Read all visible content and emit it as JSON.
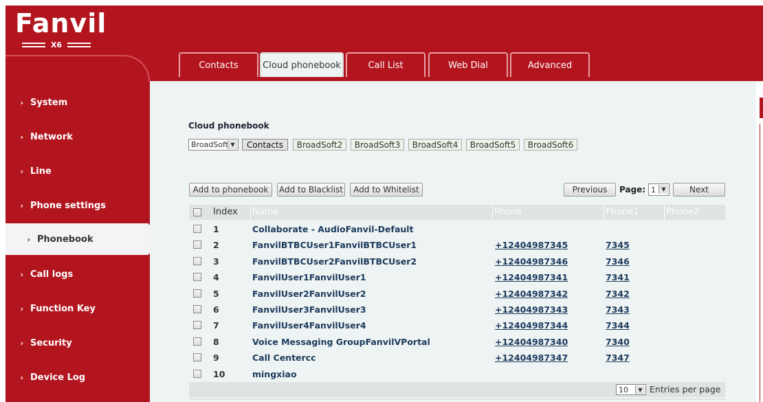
{
  "brand": {
    "name": "Fanvil",
    "model": "X6"
  },
  "nav": {
    "items": [
      {
        "label": "System"
      },
      {
        "label": "Network"
      },
      {
        "label": "Line"
      },
      {
        "label": "Phone settings"
      },
      {
        "label": "Phonebook",
        "active": true
      },
      {
        "label": "Call logs"
      },
      {
        "label": "Function Key"
      },
      {
        "label": "Security"
      },
      {
        "label": "Device Log"
      }
    ]
  },
  "tabs": [
    "Contacts",
    "Cloud phonebook",
    "Call List",
    "Web Dial",
    "Advanced"
  ],
  "active_tab": "Cloud phonebook",
  "section": {
    "title": "Cloud phonebook",
    "source_select": "BroadSoft",
    "phonebooks": [
      "Contacts",
      "BroadSoft2",
      "BroadSoft3",
      "BroadSoft4",
      "BroadSoft5",
      "BroadSoft6"
    ]
  },
  "actions": {
    "add_phonebook": "Add to phonebook",
    "add_blacklist": "Add to Blacklist",
    "add_whitelist": "Add to Whitelist",
    "previous": "Previous",
    "page_label": "Page:",
    "page_value": "1",
    "next": "Next"
  },
  "table": {
    "headers": {
      "index": "Index",
      "name": "Name",
      "phone": "Phone",
      "phone1": "Phone1",
      "phone2": "Phone2"
    },
    "rows": [
      {
        "index": "1",
        "name": "Collaborate - AudioFanvil-Default",
        "phone": "",
        "phone1": "",
        "phone2": ""
      },
      {
        "index": "2",
        "name": "FanvilBTBCUser1FanvilBTBCUser1",
        "phone": "+12404987345",
        "phone1": "7345",
        "phone2": ""
      },
      {
        "index": "3",
        "name": "FanvilBTBCUser2FanvilBTBCUser2",
        "phone": "+12404987346",
        "phone1": "7346",
        "phone2": ""
      },
      {
        "index": "4",
        "name": "FanvilUser1FanvilUser1",
        "phone": "+12404987341",
        "phone1": "7341",
        "phone2": ""
      },
      {
        "index": "5",
        "name": "FanvilUser2FanvilUser2",
        "phone": "+12404987342",
        "phone1": "7342",
        "phone2": ""
      },
      {
        "index": "6",
        "name": "FanvilUser3FanvilUser3",
        "phone": "+12404987343",
        "phone1": "7343",
        "phone2": ""
      },
      {
        "index": "7",
        "name": "FanvilUser4FanvilUser4",
        "phone": "+12404987344",
        "phone1": "7344",
        "phone2": ""
      },
      {
        "index": "8",
        "name": "Voice Messaging GroupFanvilVPortal",
        "phone": "+12404987340",
        "phone1": "7340",
        "phone2": ""
      },
      {
        "index": "9",
        "name": "Call Centercc",
        "phone": "+12404987347",
        "phone1": "7347",
        "phone2": ""
      },
      {
        "index": "10",
        "name": "mingxiao",
        "phone": "",
        "phone1": "",
        "phone2": ""
      }
    ]
  },
  "footer": {
    "entries_value": "10",
    "entries_label": "Entries per page"
  },
  "colors": {
    "brand_red": "#b3151f",
    "panel_bg": "#eef3f3",
    "link": "#1b3a5c"
  }
}
